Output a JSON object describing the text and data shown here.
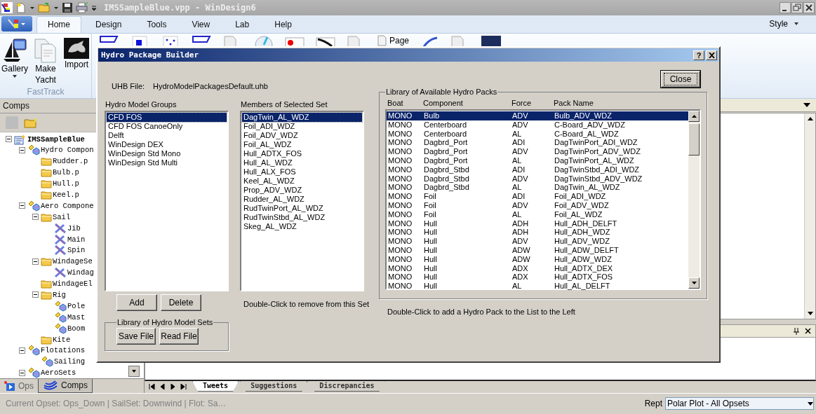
{
  "window": {
    "title": "IMSSampleBlue.vpp - WinDesign6"
  },
  "ribbon": {
    "tabs": [
      {
        "label": "Home",
        "selected": true
      },
      {
        "label": "Design",
        "selected": false
      },
      {
        "label": "Tools",
        "selected": false
      },
      {
        "label": "View",
        "selected": false
      },
      {
        "label": "Lab",
        "selected": false
      },
      {
        "label": "Help",
        "selected": false
      }
    ],
    "style_menu": "Style",
    "group": {
      "label": "FastTrack",
      "buttons": [
        {
          "label": "Gallery",
          "kind": "gallery"
        },
        {
          "label": "Make Yacht",
          "kind": "yacht"
        },
        {
          "label": "Import",
          "kind": "import"
        }
      ]
    },
    "page_button": "Page"
  },
  "left_pane": {
    "title": "Comps",
    "tree": [
      {
        "text": "IMSSampleBlue",
        "kind": "project",
        "expanded": true,
        "children": [
          {
            "text": "Hydro Compon",
            "kind": "component",
            "expanded": true,
            "children": [
              {
                "text": "Rudder.p",
                "kind": "folder"
              },
              {
                "text": "Bulb.p",
                "kind": "folder"
              },
              {
                "text": "Hull.p",
                "kind": "folder"
              },
              {
                "text": "Keel.p",
                "kind": "folder"
              }
            ]
          },
          {
            "text": "Aero Compone",
            "kind": "component",
            "expanded": true,
            "children": [
              {
                "text": "Sail",
                "kind": "folder",
                "expanded": true,
                "children": [
                  {
                    "text": "Jib",
                    "kind": "sail"
                  },
                  {
                    "text": "Main",
                    "kind": "sail"
                  },
                  {
                    "text": "Spin",
                    "kind": "sail"
                  }
                ]
              },
              {
                "text": "WindageSe",
                "kind": "folder",
                "expanded": true,
                "children": [
                  {
                    "text": "Windag",
                    "kind": "sail"
                  }
                ]
              },
              {
                "text": "WindageEl",
                "kind": "folder"
              },
              {
                "text": "Rig",
                "kind": "folder",
                "expanded": true,
                "children": [
                  {
                    "text": "Pole",
                    "kind": "component"
                  },
                  {
                    "text": "Mast",
                    "kind": "component"
                  },
                  {
                    "text": "Boom",
                    "kind": "component"
                  }
                ]
              },
              {
                "text": "Kite",
                "kind": "folder"
              }
            ]
          },
          {
            "text": "Flotations",
            "kind": "component",
            "expanded": true,
            "children": [
              {
                "text": "Sailing",
                "kind": "component"
              }
            ]
          },
          {
            "text": "AeroSets",
            "kind": "component",
            "expanded": true
          }
        ]
      }
    ],
    "tabs": [
      {
        "label": "Ops",
        "selected": false
      },
      {
        "label": "Comps",
        "selected": true
      }
    ]
  },
  "bottom_tabs": [
    {
      "label": "Tweets",
      "selected": true
    },
    {
      "label": "Suggestions",
      "selected": false
    },
    {
      "label": "Discrepancies",
      "selected": false
    }
  ],
  "status_bar": {
    "text": "Current Opset: Ops_Down | SailSet: Downwind | Flot: Sa…",
    "report_label": "Rept",
    "report_value": "Polar Plot - All Opsets"
  },
  "dialog": {
    "title": "Hydro Package Builder",
    "help_button": "?",
    "uhb_label": "UHB File:",
    "uhb_value": "HydroModelPackagesDefault.uhb",
    "close_button": "Close",
    "groups_list": {
      "label": "Hydro Model Groups",
      "items": [
        {
          "text": "CFD FOS",
          "selected": true
        },
        {
          "text": "CFD FOS CanoeOnly",
          "selected": false
        },
        {
          "text": "Delft",
          "selected": false
        },
        {
          "text": "WinDesign DEX",
          "selected": false
        },
        {
          "text": "WinDesign Std Mono",
          "selected": false
        },
        {
          "text": "WinDesign Std Multi",
          "selected": false
        }
      ]
    },
    "add_button": "Add",
    "delete_button": "Delete",
    "sets_box": {
      "label": "Library of Hydro Model Sets",
      "buttons": [
        "Save File",
        "Read File"
      ]
    },
    "members_list": {
      "label": "Members of Selected Set",
      "hint": "Double-Click to remove from this Set",
      "items": [
        {
          "text": "DagTwin_AL_WDZ",
          "selected": true
        },
        {
          "text": "Foil_ADI_WDZ",
          "selected": false
        },
        {
          "text": "Foil_ADV_WDZ",
          "selected": false
        },
        {
          "text": "Foil_AL_WDZ",
          "selected": false
        },
        {
          "text": "Hull_ADTX_FOS",
          "selected": false
        },
        {
          "text": "Hull_AL_WDZ",
          "selected": false
        },
        {
          "text": "Hull_ALX_FOS",
          "selected": false
        },
        {
          "text": "Keel_AL_WDZ",
          "selected": false
        },
        {
          "text": "Prop_ADV_WDZ",
          "selected": false
        },
        {
          "text": "Rudder_AL_WDZ",
          "selected": false
        },
        {
          "text": "RudTwinPort_AL_WDZ",
          "selected": false
        },
        {
          "text": "RudTwinStbd_AL_WDZ",
          "selected": false
        },
        {
          "text": "Skeg_AL_WDZ",
          "selected": false
        }
      ]
    },
    "library": {
      "label": "Library of Available Hydro Packs",
      "hint": "Double-Click to add a Hydro Pack to the List to the Left",
      "columns": [
        "Boat",
        "Component",
        "Force",
        "Pack Name"
      ],
      "rows": [
        {
          "cells": [
            "MONO",
            "Bulb",
            "ADV",
            "Bulb_ADV_WDZ"
          ],
          "selected": true
        },
        {
          "cells": [
            "MONO",
            "Centerboard",
            "ADV",
            "C-Board_ADV_WDZ"
          ],
          "selected": false
        },
        {
          "cells": [
            "MONO",
            "Centerboard",
            "AL",
            "C-Board_AL_WDZ"
          ],
          "selected": false
        },
        {
          "cells": [
            "MONO",
            "Dagbrd_Port",
            "ADI",
            "DagTwinPort_ADI_WDZ"
          ],
          "selected": false
        },
        {
          "cells": [
            "MONO",
            "Dagbrd_Port",
            "ADV",
            "DagTwinPort_ADV_WDZ"
          ],
          "selected": false
        },
        {
          "cells": [
            "MONO",
            "Dagbrd_Port",
            "AL",
            "DagTwinPort_AL_WDZ"
          ],
          "selected": false
        },
        {
          "cells": [
            "MONO",
            "Dagbrd_Stbd",
            "ADI",
            "DagTwinStbd_ADI_WDZ"
          ],
          "selected": false
        },
        {
          "cells": [
            "MONO",
            "Dagbrd_Stbd",
            "ADV",
            "DagTwinStbd_ADV_WDZ"
          ],
          "selected": false
        },
        {
          "cells": [
            "MONO",
            "Dagbrd_Stbd",
            "AL",
            "DagTwin_AL_WDZ"
          ],
          "selected": false
        },
        {
          "cells": [
            "MONO",
            "Foil",
            "ADI",
            "Foil_ADI_WDZ"
          ],
          "selected": false
        },
        {
          "cells": [
            "MONO",
            "Foil",
            "ADV",
            "Foil_ADV_WDZ"
          ],
          "selected": false
        },
        {
          "cells": [
            "MONO",
            "Foil",
            "AL",
            "Foil_AL_WDZ"
          ],
          "selected": false
        },
        {
          "cells": [
            "MONO",
            "Hull",
            "ADH",
            "Hull_ADH_DELFT"
          ],
          "selected": false
        },
        {
          "cells": [
            "MONO",
            "Hull",
            "ADH",
            "Hull_ADH_WDZ"
          ],
          "selected": false
        },
        {
          "cells": [
            "MONO",
            "Hull",
            "ADV",
            "Hull_ADV_WDZ"
          ],
          "selected": false
        },
        {
          "cells": [
            "MONO",
            "Hull",
            "ADW",
            "Hull_ADW_DELFT"
          ],
          "selected": false
        },
        {
          "cells": [
            "MONO",
            "Hull",
            "ADW",
            "Hull_ADW_WDZ"
          ],
          "selected": false
        },
        {
          "cells": [
            "MONO",
            "Hull",
            "ADX",
            "Hull_ADTX_DEX"
          ],
          "selected": false
        },
        {
          "cells": [
            "MONO",
            "Hull",
            "ADX",
            "Hull_ADTX_FOS"
          ],
          "selected": false
        },
        {
          "cells": [
            "MONO",
            "Hull",
            "AL",
            "Hull_AL_DELFT"
          ],
          "selected": false
        }
      ]
    }
  }
}
